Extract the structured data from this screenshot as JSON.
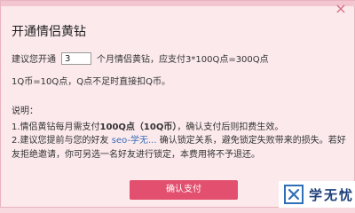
{
  "dialog": {
    "title": "开通情侣黄钻",
    "suggest_prefix": "建议您开通",
    "months_value": "3",
    "suggest_suffix": "个月情侣黄钻，应支付3*100Q点=300Q点",
    "rate_text": "1Q币=10Q点，Q点不足时直接扣Q币。",
    "notes_title": "说明：",
    "note1_prefix": "1.情侣黄钻每月需支付",
    "note1_bold": "100Q点（10Q币）",
    "note1_suffix": "，确认支付后则扣费生效。",
    "note2_prefix": "2.建议您提前与您的好友",
    "note2_link": "seo-学无...",
    "note2_suffix": "确认锁定关系，避免锁定失败带来的损失。若好友拒绝邀请，你可另选一名好友进行锁定，本费用将不予退还。",
    "confirm_button": "确认支付",
    "close_icon": "×"
  },
  "watermark": {
    "text": "学无忧",
    "logo_icon": "x-cross-logo"
  },
  "colors": {
    "dialog_bg": "#fbe9ec",
    "button_bg": "#e34f6e",
    "link": "#3a6fb7"
  }
}
